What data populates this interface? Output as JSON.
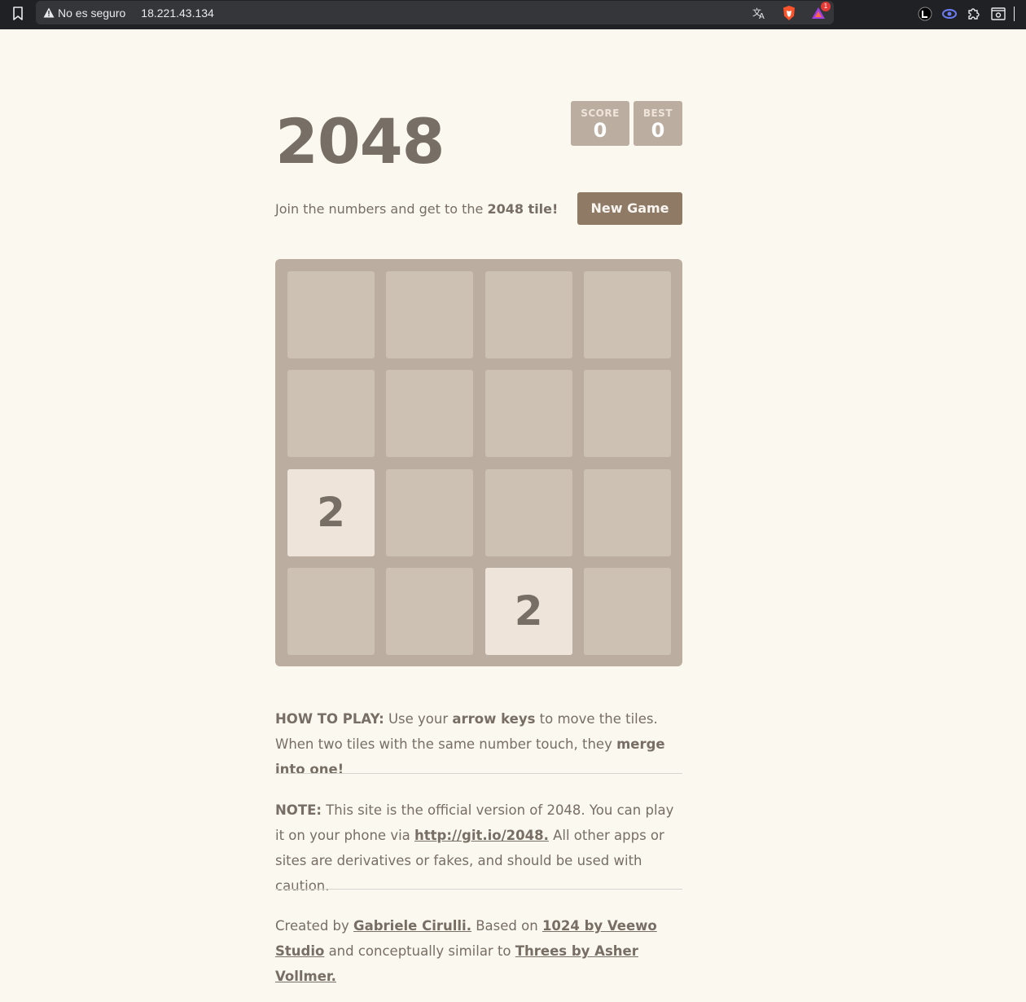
{
  "browser": {
    "security_label": "No es seguro",
    "url": "18.221.43.134",
    "notification_count": "1",
    "icons": [
      "bookmark-icon",
      "warning-icon",
      "translate-icon",
      "brave-shield-icon",
      "brave-rewards-icon",
      "extension-icon",
      "dark-reader-icon",
      "puzzle-icon",
      "screenshot-icon"
    ]
  },
  "game": {
    "title": "2048",
    "score_label": "SCORE",
    "score": "0",
    "best_label": "BEST",
    "best": "0",
    "intro_prefix": "Join the numbers and get to the ",
    "intro_bold": "2048 tile!",
    "new_game_label": "New Game",
    "grid_size": 4,
    "tiles": [
      {
        "row": 3,
        "col": 1,
        "value": "2"
      },
      {
        "row": 4,
        "col": 3,
        "value": "2"
      }
    ]
  },
  "how_to_play": {
    "label": "HOW TO PLAY:",
    "text1": " Use your ",
    "bold1": "arrow keys",
    "text2": " to move the tiles. When two tiles with the same number touch, they ",
    "bold2": "merge into one!"
  },
  "note": {
    "label": "NOTE:",
    "text1": " This site is the official version of 2048. You can play it on your phone via ",
    "link": "http://git.io/2048.",
    "text2": " All other apps or sites are derivatives or fakes, and should be used with caution."
  },
  "credits": {
    "text1": "Created by ",
    "author_link": "Gabriele Cirulli.",
    "text2": " Based on ",
    "based_link": "1024 by Veewo Studio",
    "text3": " and conceptually similar to ",
    "similar_link": "Threes by Asher Vollmer."
  },
  "colors": {
    "background": "#faf8ef",
    "board": "#bbada0",
    "empty_cell": "#cdc1b4",
    "tile_2": "#eee4da",
    "button": "#8f7a66",
    "text": "#776e65"
  }
}
